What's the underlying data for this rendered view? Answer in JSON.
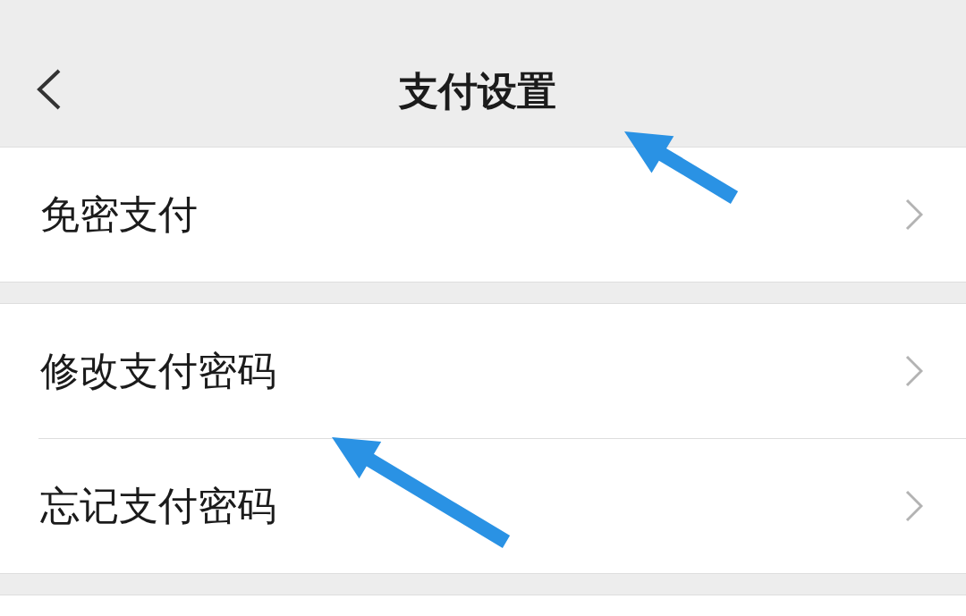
{
  "nav_bar": {
    "title": "支付设置"
  },
  "groups": [
    {
      "items": [
        {
          "label": "免密支付"
        }
      ]
    },
    {
      "items": [
        {
          "label": "修改支付密码"
        },
        {
          "label": "忘记支付密码"
        }
      ]
    }
  ]
}
